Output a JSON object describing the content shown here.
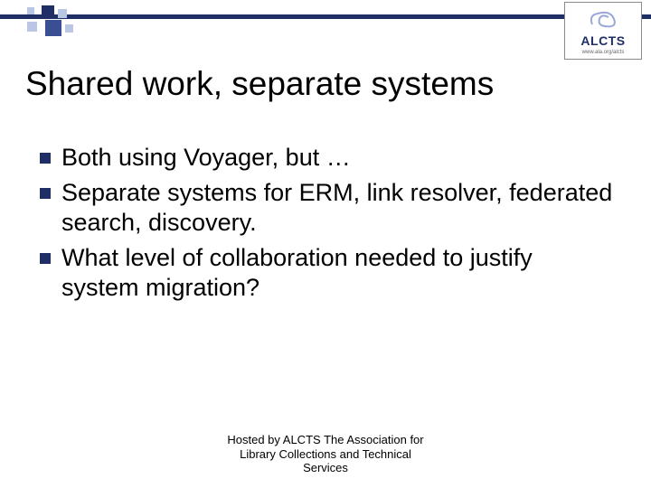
{
  "logo": {
    "acronym": "ALCTS",
    "url_text": "www.ala.org/alcts"
  },
  "title": "Shared work, separate systems",
  "bullets": [
    "Both using Voyager, but …",
    "Separate systems for ERM, link resolver, federated search, discovery.",
    "What level of collaboration needed to justify system migration?"
  ],
  "footer_lines": [
    "Hosted by ALCTS The Association for",
    "Library Collections and Technical",
    "Services"
  ]
}
